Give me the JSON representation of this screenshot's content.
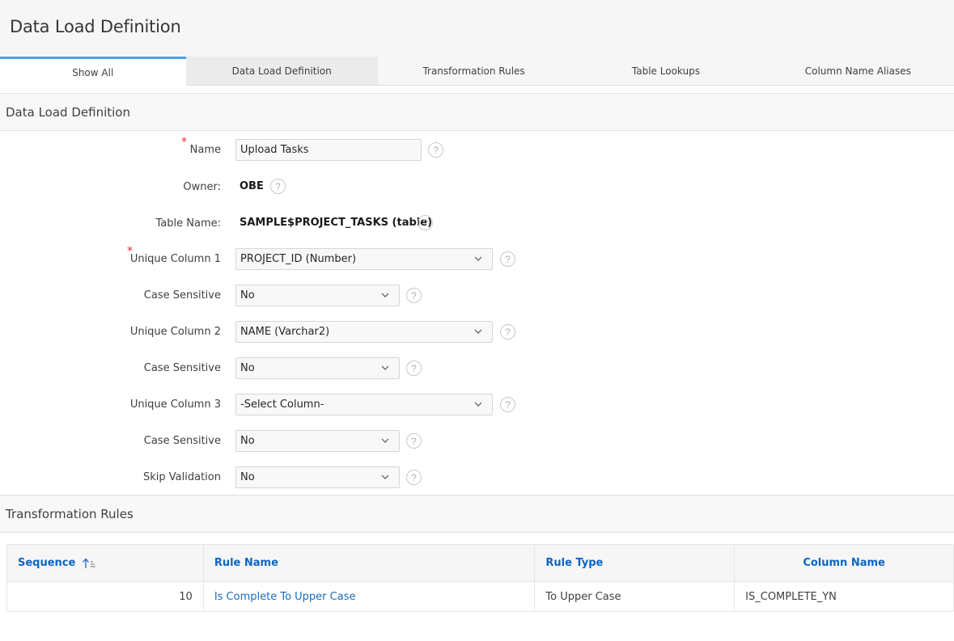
{
  "page": {
    "title": "Data Load Definition"
  },
  "tabs": [
    {
      "label": "Show All",
      "state": "active"
    },
    {
      "label": "Data Load Definition",
      "state": "hover"
    },
    {
      "label": "Transformation Rules",
      "state": "normal"
    },
    {
      "label": "Table Lookups",
      "state": "normal"
    },
    {
      "label": "Column Name Aliases",
      "state": "normal"
    }
  ],
  "definition_region": {
    "title": "Data Load Definition",
    "fields": {
      "name": {
        "label": "Name",
        "required": true,
        "value": "Upload Tasks"
      },
      "owner": {
        "label": "Owner:",
        "value": "OBE"
      },
      "table_name": {
        "label": "Table Name:",
        "value": "SAMPLE$PROJECT_TASKS (table)"
      },
      "unique_column_1": {
        "label": "Unique Column 1",
        "required": true,
        "value": "PROJECT_ID (Number)"
      },
      "case_sensitive_1": {
        "label": "Case Sensitive",
        "value": "No"
      },
      "unique_column_2": {
        "label": "Unique Column 2",
        "value": "NAME (Varchar2)"
      },
      "case_sensitive_2": {
        "label": "Case Sensitive",
        "value": "No"
      },
      "unique_column_3": {
        "label": "Unique Column 3",
        "value": "-Select Column-"
      },
      "case_sensitive_3": {
        "label": "Case Sensitive",
        "value": "No"
      },
      "skip_validation": {
        "label": "Skip Validation",
        "value": "No"
      }
    },
    "help_icon_glyph": "?",
    "required_glyph": "*"
  },
  "rules_region": {
    "title": "Transformation Rules",
    "columns": [
      "Sequence",
      "Rule Name",
      "Rule Type",
      "Column Name"
    ],
    "sort": {
      "column": "Sequence",
      "direction": "ascending"
    },
    "rows": [
      {
        "sequence": "10",
        "rule_name": "Is Complete To Upper Case",
        "rule_type": "To Upper Case",
        "column_name": "IS_COMPLETE_YN"
      }
    ]
  },
  "colors": {
    "accent": "#4b9fe0",
    "link": "#1d6bb8",
    "header_link": "#0a66c2",
    "required": "#e0292b"
  }
}
